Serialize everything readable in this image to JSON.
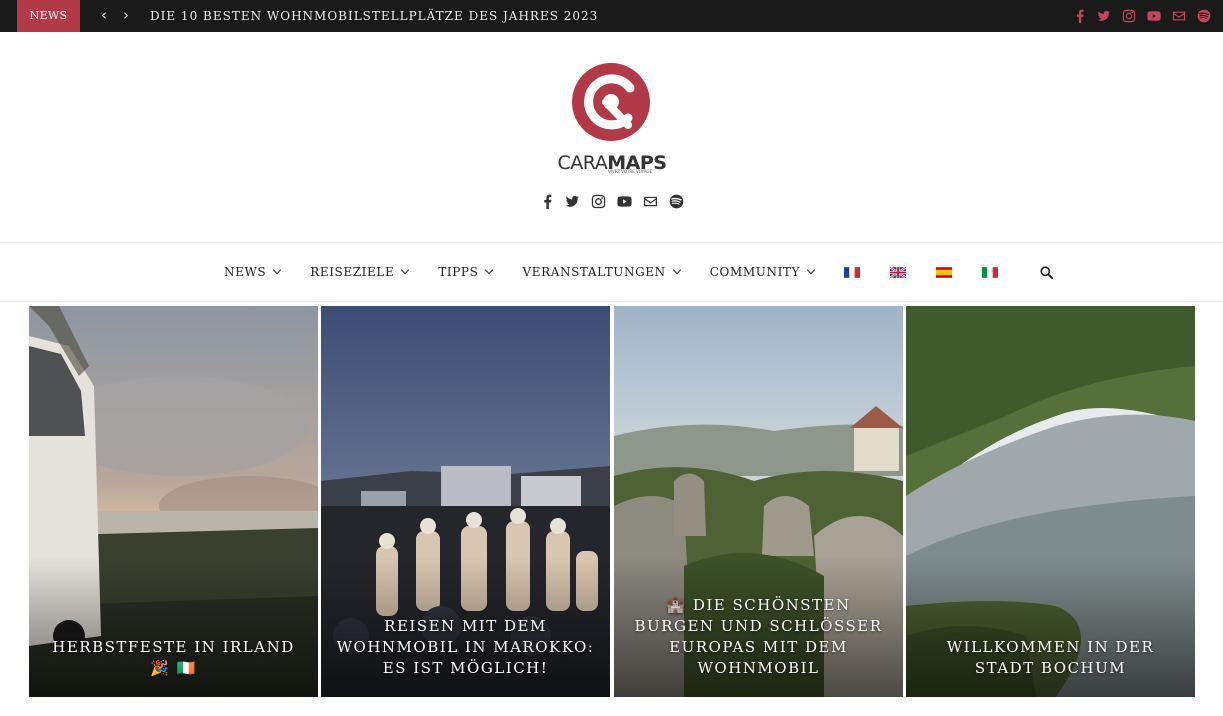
{
  "topbar": {
    "badge": "NEWS",
    "ticker": "DIE 10 BESTEN WOHNMOBILSTELLPLÄTZE DES JAHRES 2023",
    "prev_icon": "chevron-left-icon",
    "next_icon": "chevron-right-icon",
    "social_icons": [
      "facebook-icon",
      "twitter-icon",
      "instagram-icon",
      "youtube-icon",
      "envelope-icon",
      "spotify-icon"
    ]
  },
  "logo": {
    "part1": "CARA",
    "part2": "MAPS",
    "tagline": "VIVEZ VOTRE VOYAGE"
  },
  "nav": {
    "items": [
      {
        "label": "NEWS"
      },
      {
        "label": "REISEZIELE"
      },
      {
        "label": "TIPPS"
      },
      {
        "label": "VERANSTALTUNGEN"
      },
      {
        "label": "COMMUNITY"
      }
    ],
    "languages": [
      "fr-flag-icon",
      "uk-flag-icon",
      "es-flag-icon",
      "it-flag-icon"
    ],
    "search_icon": "search-icon"
  },
  "cards": [
    {
      "title": "HERBSTFESTE IN IRLAND 🎉 🇮🇪"
    },
    {
      "title": "REISEN MIT DEM WOHNMOBIL IN MAROKKO: ES IST MÖGLICH!"
    },
    {
      "title": "🏰 DIE SCHÖNSTEN BURGEN UND SCHLÖSSER EUROPAS MIT DEM WOHNMOBIL"
    },
    {
      "title": "WILLKOMMEN IN DER STADT BOCHUM"
    }
  ],
  "colors": {
    "accent": "#b23a48",
    "topbar": "#1a1a1a"
  }
}
